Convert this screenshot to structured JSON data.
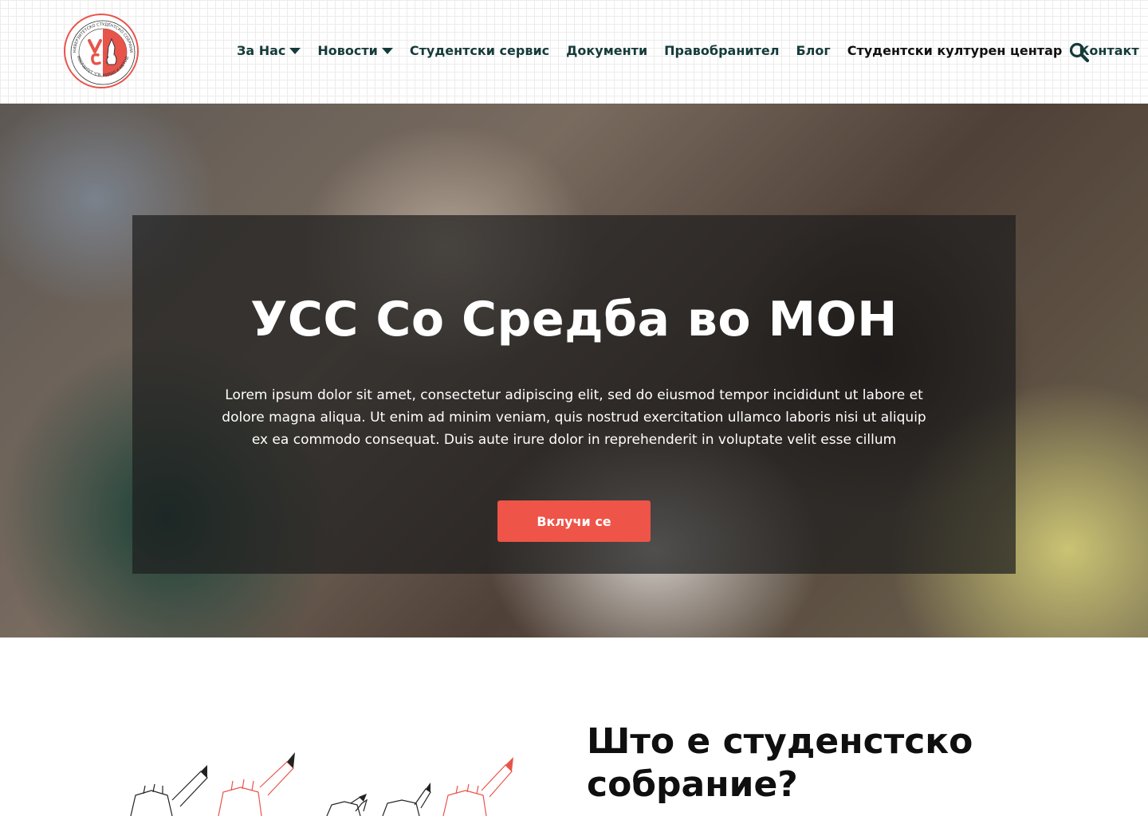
{
  "logo": {
    "ring_text_top": "УНИВЕРЗИТЕТСКО СТУДЕНТСКО СОБРАНИЕ",
    "ring_text_bottom": "УНИВЕРЗИТЕТ \"СВ. КИРИЛ И МЕТОДИЈ\"",
    "accent_color": "#e8544a"
  },
  "nav": {
    "items": [
      {
        "label": "За Нас",
        "has_dropdown": true
      },
      {
        "label": "Новости",
        "has_dropdown": true
      },
      {
        "label": "Студентски сервис",
        "has_dropdown": false
      },
      {
        "label": "Документи",
        "has_dropdown": false
      },
      {
        "label": "Правобранител",
        "has_dropdown": false
      },
      {
        "label": "Блог",
        "has_dropdown": false
      },
      {
        "label": "Студентски културен центар",
        "has_dropdown": false
      },
      {
        "label": "Контакт",
        "has_dropdown": false
      }
    ],
    "search_icon": "search-icon"
  },
  "hero": {
    "title": "УСС Со Средба во МОН",
    "text": "Lorem ipsum dolor sit amet, consectetur adipiscing elit, sed do eiusmod tempor incididunt ut labore et dolore magna aliqua. Ut enim ad minim veniam, quis nostrud exercitation ullamco laboris nisi ut aliquip ex ea commodo consequat. Duis aute irure dolor in reprehenderit in voluptate velit esse cillum",
    "button_label": "Вклучи се",
    "button_color": "#ef5448"
  },
  "about": {
    "title": "Што е студенстско собрание?"
  },
  "colors": {
    "nav_text": "#163a3a",
    "accent": "#ef5448"
  }
}
